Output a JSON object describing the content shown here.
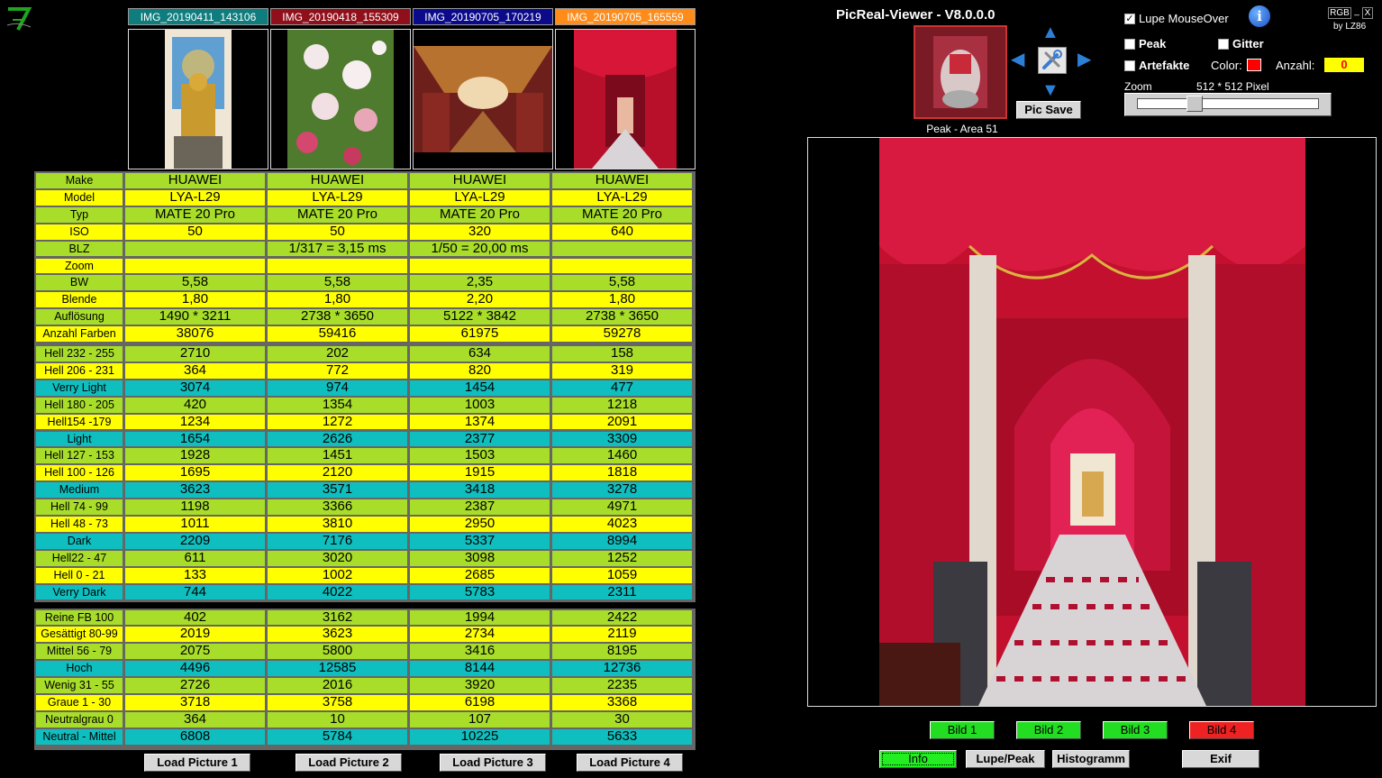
{
  "images": [
    {
      "tab": "IMG_20190411_143106",
      "tab_color": "#0f7d7d"
    },
    {
      "tab": "IMG_20190418_155309",
      "tab_color": "#8f0f1a"
    },
    {
      "tab": "IMG_20190705_170219",
      "tab_color": "#0a0a8a"
    },
    {
      "tab": "IMG_20190705_165559",
      "tab_color": "#ff8c1a"
    }
  ],
  "table": {
    "rows": [
      {
        "label": "Make",
        "color": "green",
        "values": [
          "HUAWEI",
          "HUAWEI",
          "HUAWEI",
          "HUAWEI"
        ]
      },
      {
        "label": "Model",
        "color": "yellow",
        "values": [
          "LYA-L29",
          "LYA-L29",
          "LYA-L29",
          "LYA-L29"
        ]
      },
      {
        "label": "Typ",
        "color": "green",
        "values": [
          "MATE 20 Pro",
          "MATE 20 Pro",
          "MATE 20 Pro",
          "MATE 20 Pro"
        ]
      },
      {
        "label": "ISO",
        "color": "yellow",
        "values": [
          "50",
          "50",
          "320",
          "640"
        ]
      },
      {
        "label": "BLZ",
        "color": "green",
        "values": [
          "",
          "1/317 = 3,15 ms",
          "1/50 = 20,00 ms",
          ""
        ]
      },
      {
        "label": "Zoom",
        "color": "yellow",
        "values": [
          "",
          "",
          "",
          ""
        ]
      },
      {
        "label": "BW",
        "color": "green",
        "values": [
          "5,58",
          "5,58",
          "2,35",
          "5,58"
        ]
      },
      {
        "label": "Blende",
        "color": "yellow",
        "values": [
          "1,80",
          "1,80",
          "2,20",
          "1,80"
        ]
      },
      {
        "label": "Auflösung",
        "color": "green",
        "values": [
          "1490 * 3211",
          "2738 * 3650",
          "5122 * 3842",
          "2738 * 3650"
        ]
      },
      {
        "label": "Anzahl Farben",
        "color": "yellow",
        "values": [
          "38076",
          "59416",
          "61975",
          "59278"
        ]
      },
      {
        "label": "Hell 232 - 255",
        "color": "green",
        "values": [
          "2710",
          "202",
          "634",
          "158"
        ]
      },
      {
        "label": "Hell 206 - 231",
        "color": "yellow",
        "values": [
          "364",
          "772",
          "820",
          "319"
        ]
      },
      {
        "label": "Verry Light",
        "color": "teal",
        "values": [
          "3074",
          "974",
          "1454",
          "477"
        ]
      },
      {
        "label": "Hell 180 - 205",
        "color": "green",
        "values": [
          "420",
          "1354",
          "1003",
          "1218"
        ]
      },
      {
        "label": "Hell154 -179",
        "color": "yellow",
        "values": [
          "1234",
          "1272",
          "1374",
          "2091"
        ]
      },
      {
        "label": "Light",
        "color": "teal",
        "values": [
          "1654",
          "2626",
          "2377",
          "3309"
        ]
      },
      {
        "label": "Hell 127 - 153",
        "color": "green",
        "values": [
          "1928",
          "1451",
          "1503",
          "1460"
        ]
      },
      {
        "label": "Hell 100 - 126",
        "color": "yellow",
        "values": [
          "1695",
          "2120",
          "1915",
          "1818"
        ]
      },
      {
        "label": "Medium",
        "color": "teal",
        "values": [
          "3623",
          "3571",
          "3418",
          "3278"
        ]
      },
      {
        "label": "Hell 74 - 99",
        "color": "green",
        "values": [
          "1198",
          "3366",
          "2387",
          "4971"
        ]
      },
      {
        "label": "Hell 48 - 73",
        "color": "yellow",
        "values": [
          "1011",
          "3810",
          "2950",
          "4023"
        ]
      },
      {
        "label": "Dark",
        "color": "teal",
        "values": [
          "2209",
          "7176",
          "5337",
          "8994"
        ]
      },
      {
        "label": "Hell22 - 47",
        "color": "green",
        "values": [
          "611",
          "3020",
          "3098",
          "1252"
        ]
      },
      {
        "label": "Hell 0 - 21",
        "color": "yellow",
        "values": [
          "133",
          "1002",
          "2685",
          "1059"
        ]
      },
      {
        "label": "Verry Dark",
        "color": "teal",
        "values": [
          "744",
          "4022",
          "5783",
          "2311"
        ]
      },
      {
        "label": "Reine FB 100",
        "color": "green",
        "values": [
          "402",
          "3162",
          "1994",
          "2422"
        ]
      },
      {
        "label": "Gesättigt 80-99",
        "color": "yellow",
        "values": [
          "2019",
          "3623",
          "2734",
          "2119"
        ]
      },
      {
        "label": "Mittel 56 - 79",
        "color": "green",
        "values": [
          "2075",
          "5800",
          "3416",
          "8195"
        ]
      },
      {
        "label": "Hoch",
        "color": "teal",
        "values": [
          "4496",
          "12585",
          "8144",
          "12736"
        ]
      },
      {
        "label": "Wenig 31 - 55",
        "color": "green",
        "values": [
          "2726",
          "2016",
          "3920",
          "2235"
        ]
      },
      {
        "label": "Graue 1 - 30",
        "color": "yellow",
        "values": [
          "3718",
          "3758",
          "6198",
          "3368"
        ]
      },
      {
        "label": "Neutralgrau 0",
        "color": "green",
        "values": [
          "364",
          "10",
          "107",
          "30"
        ]
      },
      {
        "label": "Neutral - Mittel",
        "color": "teal",
        "values": [
          "6808",
          "5784",
          "10225",
          "5633"
        ]
      }
    ]
  },
  "load_buttons": [
    "Load Picture 1",
    "Load Picture 2",
    "Load Picture 3",
    "Load Picture 4"
  ],
  "header": {
    "title": "PicReal-Viewer - V8.0.0.0",
    "rgb": "RGB",
    "minimize": "_",
    "close": "X",
    "by": "by LZ86",
    "info": "i"
  },
  "loupe": {
    "caption": "Peak - Area 51",
    "pic_save": "Pic Save"
  },
  "options": {
    "lupe_mouseover": {
      "label": "Lupe MouseOver",
      "checked": true
    },
    "peak": {
      "label": "Peak",
      "checked": false
    },
    "gitter": {
      "label": "Gitter",
      "checked": false
    },
    "artefakte": {
      "label": "Artefakte",
      "checked": false
    },
    "color_label": "Color:",
    "color_value": "#ff0000",
    "anzahl_label": "Anzahl:",
    "anzahl_value": "0"
  },
  "zoom": {
    "label": "Zoom",
    "value": "512 * 512 Pixel",
    "slider_position": 0.3
  },
  "bild_buttons": [
    {
      "label": "Bild 1",
      "color": "#22dd22"
    },
    {
      "label": "Bild 2",
      "color": "#22dd22"
    },
    {
      "label": "Bild 3",
      "color": "#22dd22"
    },
    {
      "label": "Bild 4",
      "color": "#ee2222"
    }
  ],
  "control_buttons": [
    "Info",
    "Lupe/Peak",
    "Histogramm",
    "Exif"
  ],
  "icons": {
    "logo": "seven-logo-icon",
    "info": "info-icon",
    "tools": "tools-icon"
  }
}
